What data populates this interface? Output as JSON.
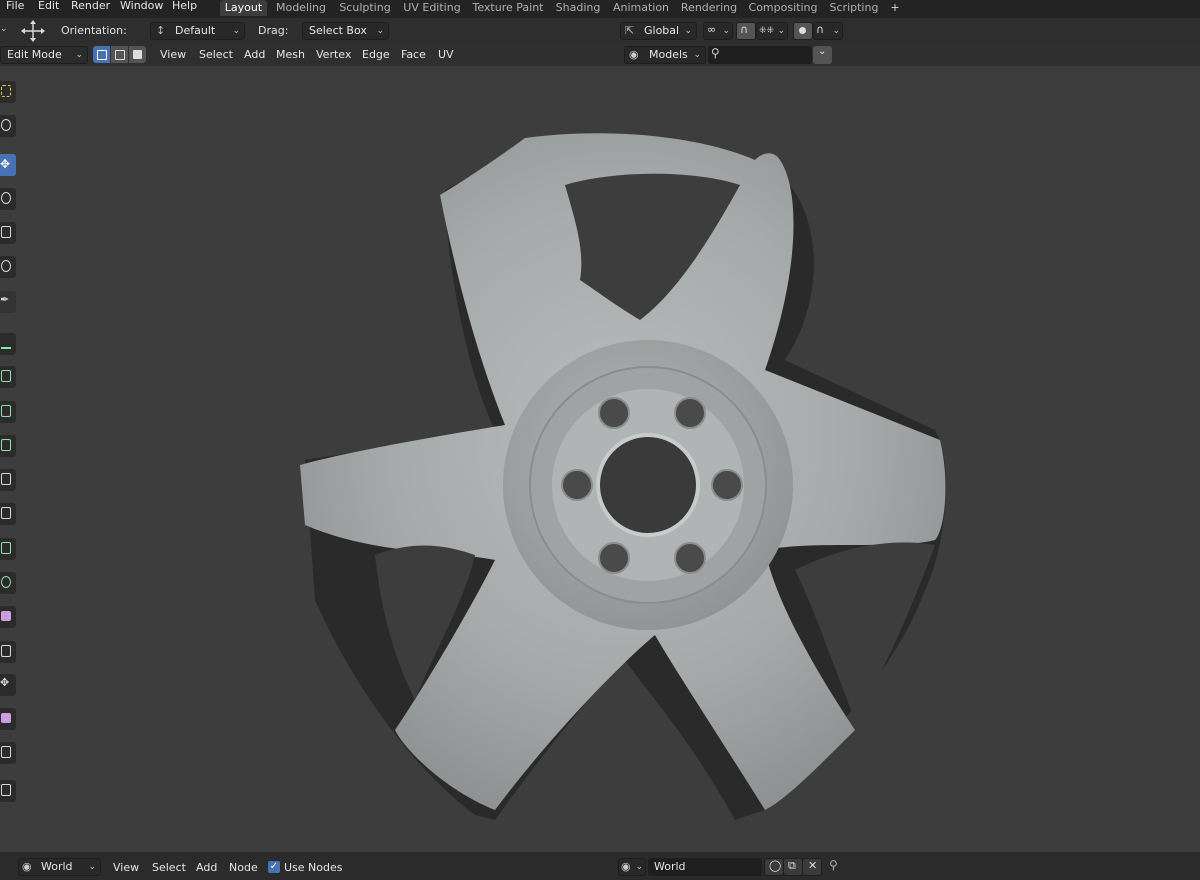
{
  "topbar": {
    "menus": [
      "File",
      "Edit",
      "Render",
      "Window",
      "Help"
    ],
    "workspaces": [
      "Layout",
      "Modeling",
      "Sculpting",
      "UV Editing",
      "Texture Paint",
      "Shading",
      "Animation",
      "Rendering",
      "Compositing",
      "Scripting"
    ],
    "active_workspace": "Layout",
    "add_tab": "+"
  },
  "tool_settings": {
    "orientation_label": "Orientation:",
    "orientation_value": "Default",
    "drag_label": "Drag:",
    "drag_value": "Select Box",
    "transform_orientation": "Global"
  },
  "header": {
    "mode": "Edit Mode",
    "menus": [
      "View",
      "Select",
      "Add",
      "Mesh",
      "Vertex",
      "Edge",
      "Face",
      "UV"
    ],
    "collection_filter": "Models",
    "search_value": ""
  },
  "viewport": {
    "object": "wheel-rim",
    "spokes": 5,
    "lug_holes": 6
  },
  "bottom_header": {
    "world_selector": "World",
    "menus": [
      "View",
      "Select",
      "Add",
      "Node"
    ],
    "use_nodes_label": "Use Nodes",
    "use_nodes_checked": true,
    "world_name": "World"
  },
  "colors": {
    "accent": "#4772b3",
    "viewport_bg": "#3d3d3d",
    "wheel_surface": "#a9acac"
  }
}
